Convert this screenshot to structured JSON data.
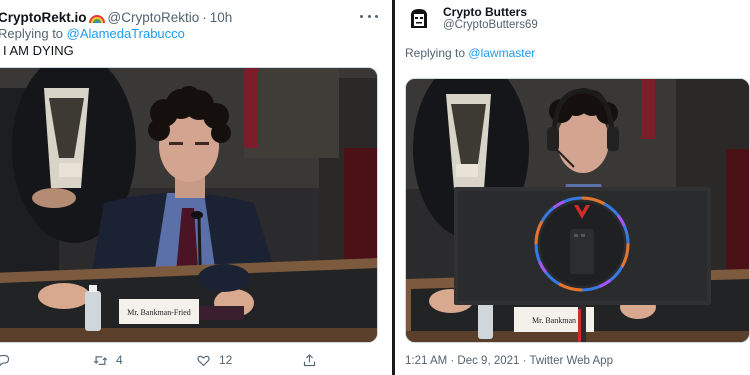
{
  "left_tweet": {
    "display_name": "CryptoRekt.io",
    "name_emoji": "rainbow-emoji",
    "handle": "@CryptoRektio",
    "separator": "·",
    "time": "10h",
    "replying_prefix": "Replying to",
    "replying_to": "@AlamedaTrabucco",
    "text": "I AM DYING",
    "media": {
      "nameplate": "Mr. Bankman-Fried"
    },
    "actions": {
      "reply_icon": "reply-icon",
      "retweet_icon": "retweet-icon",
      "retweet_count": "4",
      "like_icon": "heart-icon",
      "like_count": "12",
      "share_icon": "share-icon"
    }
  },
  "right_tweet": {
    "display_name": "Crypto Butters",
    "handle": "@CryptoButters69",
    "replying_prefix": "Replying to",
    "replying_to": "@lawmaster",
    "media": {
      "nameplate": "Mr. Bankman"
    },
    "timestamp": "1:21 AM · Dec 9, 2021 · Twitter Web App"
  },
  "colors": {
    "link": "#1d9bf0",
    "secondary_text": "#536471",
    "primary_text": "#0f1419",
    "divider": "#1a1a1a"
  }
}
